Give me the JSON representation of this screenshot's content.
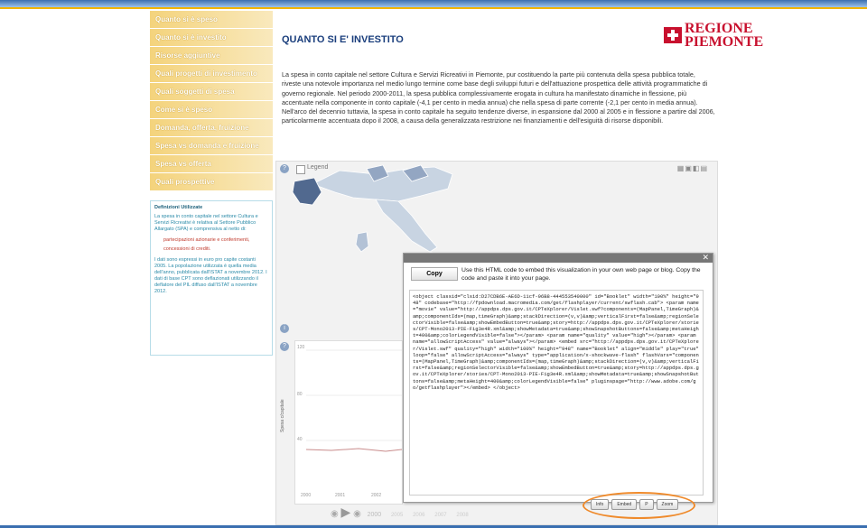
{
  "sidebar": {
    "items": [
      {
        "label": "Quanto si è speso"
      },
      {
        "label": "Quanto si è investito"
      },
      {
        "label": "Risorse aggiuntive"
      },
      {
        "label": "Quali progetti di investimento"
      },
      {
        "label": "Quali soggetti di spesa"
      },
      {
        "label": "Come si è speso"
      },
      {
        "label": "Domanda, offerta, fruizione"
      },
      {
        "label": "Spesa vs domanda e fruizione"
      },
      {
        "label": "Spesa vs offerta"
      },
      {
        "label": "Quali prospettive"
      }
    ]
  },
  "definitions": {
    "title": "Definizioni Utilizzate",
    "intro": "La spesa in conto capitale nel settore Cultura e Servizi Ricreativi è relativa al Settore Pubblico Allargato (SPA) e comprensiva al netto di:",
    "items": [
      "partecipazioni azionarie e conferimenti,",
      "concessioni di crediti."
    ],
    "note": "I dati sono espressi in euro pro capite costanti 2005. La popolazione utilizzata è quella media dell'anno, pubblicata dall'ISTAT a novembre 2012. I dati di base CPT sono deflazionati utilizzando il deflatore del PIL diffuso dall'ISTAT a novembre 2012."
  },
  "page": {
    "title": "QUANTO SI E' INVESTITO",
    "logo_line1": "REGIONE",
    "logo_line2": "PIEMONTE",
    "intro": "La spesa in conto capitale nel settore Cultura e Servizi Ricreativi in Piemonte, pur costituendo la parte più contenuta della spesa pubblica totale, riveste una notevole importanza nel medio lungo termine come base degli sviluppi futuri e dell'attuazione prospettica delle attività programmatiche di governo regionale. Nel periodo 2000-2011, la spesa pubblica complessivamente erogata in cultura ha manifestato dinamiche in flessione, più accentuate nella componente in conto capitale (-4,1 per cento in media annua) che nella spesa di parte corrente (-2,1 per cento in media annua). Nell'arco del decennio tuttavia, la spesa in conto capitale ha seguito tendenze diverse, in espansione dal 2000 al 2005 e in flessione a partire dal 2006, particolarmente accentuata dopo il 2008, a causa della generalizzata restrizione nei finanziamenti e dell'esiguità di risorse disponibili."
  },
  "viz": {
    "legend_label": "Legend",
    "graph_ylabel": "Spesa c/capitale",
    "y_ticks": [
      "120",
      "80",
      "40"
    ],
    "x_ticks": [
      "2000",
      "2001",
      "2002"
    ],
    "year_label": "2000",
    "timeline_years": [
      "2005",
      "2006",
      "2007",
      "2008"
    ]
  },
  "embed": {
    "copy_label": "Copy",
    "info": "Use this HTML code to embed this visualization in your own web page or blog. Copy the code and paste it into your page.",
    "code": "<object classid=\"clsid:D27CDB6E-AE6D-11cf-96B8-444553540000\" id=\"Booklet\" width=\"100%\" height=\"948\" codebase=\"http://fpdownload.macromedia.com/get/flashplayer/current/swflash.cab\"> <param name=\"movie\" value=\"http://appdps.dps.gov.it/CPTeXplorer/Vislet.swf?components=(MapPanel,TimeGraph)&amp;componentIds=(map,timeGraph)&amp;stackDirection=(v,v)&amp;verticalFirst=false&amp;regionSelectorVisible=false&amp;showEmbedButton=true&amp;story=http://appdps.dps.gov.it/CPTeXplorer/stories/CPT-Mono2013-PIE-Fig3e4R.xml&amp;showMetadata=true&amp;showSnapshotButtons=false&amp;metaHeight=400&amp;colorLegendVisible=false\"></param> <param name=\"quality\" value=\"high\"></param> <param name=\"allowScriptAccess\" value=\"always\"></param> <embed src=\"http://appdps.dps.gov.it/CPTeXplorer/Vislet.swf\" quality=\"high\" width=\"100%\" height=\"948\" name=\"Booklet\" align=\"middle\" play=\"true\" loop=\"false\" allowScriptAccess=\"always\" type=\"application/x-shockwave-flash\" flashVars=\"components=(MapPanel,TimeGraph)&amp;componentIds=(map,timeGraph)&amp;stackDirection=(v,v)&amp;verticalFirst=false&amp;regionSelectorVisible=false&amp;showEmbedButton=true&amp;story=http://appdps.dps.gov.it/CPTeXplorer/stories/CPT-Mono2013-PIE-Fig3e4R.xml&amp;showMetadata=true&amp;showSnapshotButtons=false&amp;metaHeight=400&amp;colorLegendVisible=false\" pluginspage=\"http://www.adobe.com/go/getflashplayer\"></embed> </object>"
  },
  "bottom": {
    "btn1": "Info",
    "btn2": "Embed",
    "btn3": "P",
    "btn4": "Zoom"
  }
}
